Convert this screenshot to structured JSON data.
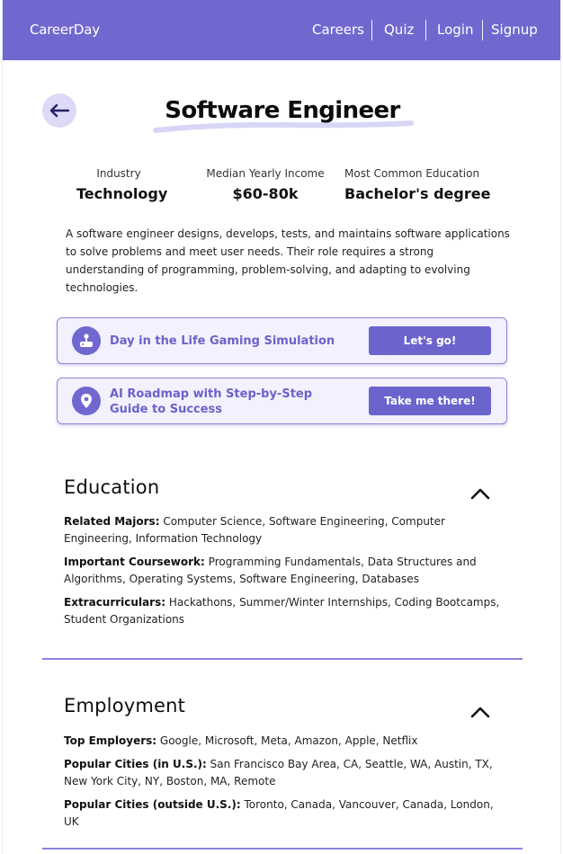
{
  "header": {
    "brand": "CareerDay",
    "nav": [
      "Careers",
      "Quiz",
      "Login",
      "Signup"
    ]
  },
  "page": {
    "title": "Software Engineer",
    "stats": [
      {
        "label": "Industry",
        "value": "Technology"
      },
      {
        "label": "Median Yearly Income",
        "value": "$60-80k"
      },
      {
        "label": "Most Common Education",
        "value": "Bachelor's degree"
      }
    ],
    "description": "A software engineer designs, develops, tests, and maintains software applications to solve problems and meet user needs. Their role requires a strong understanding of programming, problem-solving, and adapting to evolving technologies."
  },
  "cards": [
    {
      "text": "Day in the Life Gaming Simulation",
      "button": "Let's go!",
      "icon": "game-controller-icon"
    },
    {
      "text": "AI Roadmap with Step-by-Step Guide to Success",
      "button": "Take me there!",
      "icon": "map-pin-icon"
    }
  ],
  "education": {
    "title": "Education",
    "items": [
      {
        "label": "Related Majors:",
        "value": "Computer Science, Software Engineering, Computer Engineering, Information Technology"
      },
      {
        "label": "Important Coursework:",
        "value": "Programming Fundamentals, Data Structures and Algorithms, Operating Systems, Software Engineering, Databases"
      },
      {
        "label": "Extracurriculars:",
        "value": "Hackathons, Summer/Winter Internships, Coding Bootcamps, Student Organizations"
      }
    ]
  },
  "employment": {
    "title": "Employment",
    "items": [
      {
        "label": "Top Employers:",
        "value": "Google, Microsoft, Meta,  Amazon, Apple, Netflix"
      },
      {
        "label": "Popular Cities (in U.S.):",
        "value": "San Francisco Bay Area, CA,  Seattle, WA, Austin, TX, New York City, NY, Boston, MA, Remote"
      },
      {
        "label": "Popular Cities (outside U.S.):",
        "value": "Toronto, Canada, Vancouver, Canada, London, UK"
      }
    ]
  },
  "colors": {
    "primary": "#7068cf",
    "card_bg": "#f2f1fd",
    "back_button_bg": "#dcdaf7"
  }
}
